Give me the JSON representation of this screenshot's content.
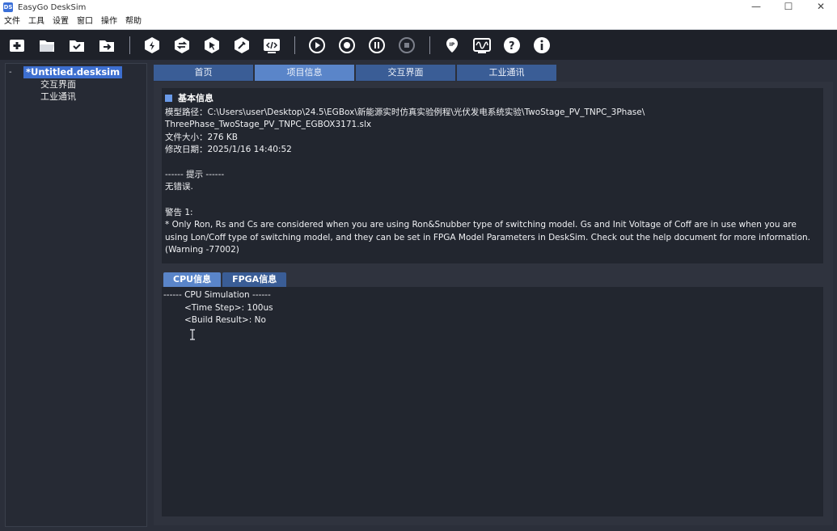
{
  "window": {
    "app_icon_text": "DS",
    "title": "EasyGo DeskSim",
    "minimize": "—",
    "maximize": "☐",
    "close": "✕"
  },
  "menu": [
    "文件",
    "工具",
    "设置",
    "窗口",
    "操作",
    "帮助"
  ],
  "toolbar": {
    "icons": [
      "new-file-icon",
      "open-folder-icon",
      "save-icon",
      "export-icon",
      "build-icon",
      "sync-icon",
      "cursor-target-icon",
      "tools-icon",
      "code-icon",
      "play-icon",
      "record-icon",
      "pause-icon",
      "stop-icon",
      "ip-icon",
      "waveform-icon",
      "help-icon",
      "info-icon"
    ]
  },
  "tree": {
    "toggle": "-",
    "root": "*Untitled.desksim",
    "children": [
      "交互界面",
      "工业通讯"
    ]
  },
  "tabs": [
    "首页",
    "项目信息",
    "交互界面",
    "工业通讯"
  ],
  "active_tab": 1,
  "basic_info": {
    "title": "基本信息",
    "path_line1": "模型路径：C:\\Users\\user\\Desktop\\24.5\\EGBox\\新能源实时仿真实验例程\\光伏发电系统实验\\TwoStage_PV_TNPC_3Phase\\",
    "path_line2": "ThreePhase_TwoStage_PV_TNPC_EGBOX3171.slx",
    "file_size": "文件大小：276 KB",
    "modified": "修改日期：2025/1/16 14:40:52",
    "hint_header": "------ 提示 ------",
    "hint_text": "无错误.",
    "warning_label": "警告 1:",
    "warning_text": " * Only Ron, Rs and Cs are considered when you are using Ron&Snubber type of switching model. Gs and Init Voltage of Coff are in use when you are using Lon/Coff type of switching model, and they can be set in FPGA Model Parameters in DeskSim. Check out the help document for more information. (Warning -77002)"
  },
  "subtabs": [
    "CPU信息",
    "FPGA信息"
  ],
  "console": {
    "header": "------ CPU Simulation ------",
    "time_step": "<Time Step>: 100us",
    "build_result": "<Build Result>: No"
  }
}
